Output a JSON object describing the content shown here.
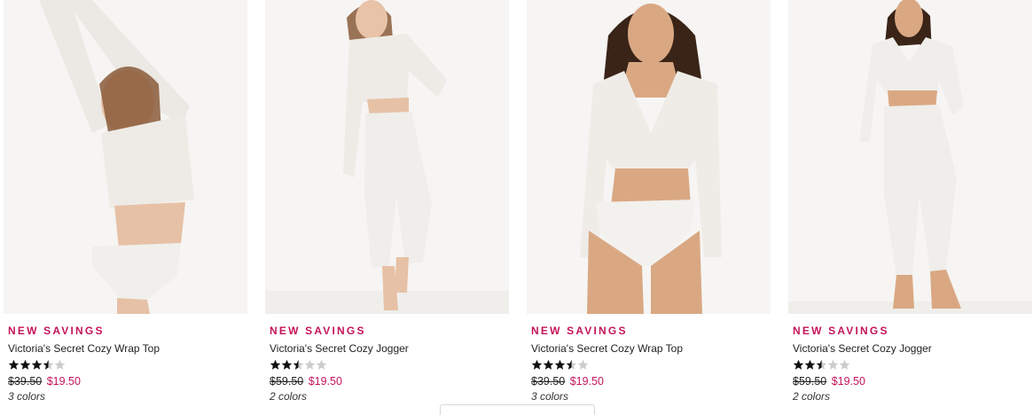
{
  "products": [
    {
      "promo": "NEW SAVINGS",
      "name": "Victoria's Secret Cozy Wrap Top",
      "rating": 3.5,
      "old_price": "$39.50",
      "new_price": "$19.50",
      "colors": "3 colors"
    },
    {
      "promo": "NEW SAVINGS",
      "name": "Victoria's Secret Cozy Jogger",
      "rating": 2.5,
      "old_price": "$59.50",
      "new_price": "$19.50",
      "colors": "2 colors"
    },
    {
      "promo": "NEW SAVINGS",
      "name": "Victoria's Secret Cozy Wrap Top",
      "rating": 3.5,
      "old_price": "$39.50",
      "new_price": "$19.50",
      "colors": "3 colors"
    },
    {
      "promo": "NEW SAVINGS",
      "name": "Victoria's Secret Cozy Jogger",
      "rating": 2.5,
      "old_price": "$59.50",
      "new_price": "$19.50",
      "colors": "2 colors"
    }
  ],
  "colors": {
    "promo": "#c4145a",
    "sale_price": "#c4145a",
    "star_filled": "#111111",
    "star_empty": "#cccccc",
    "photo_bg": "#f4f3f1"
  }
}
